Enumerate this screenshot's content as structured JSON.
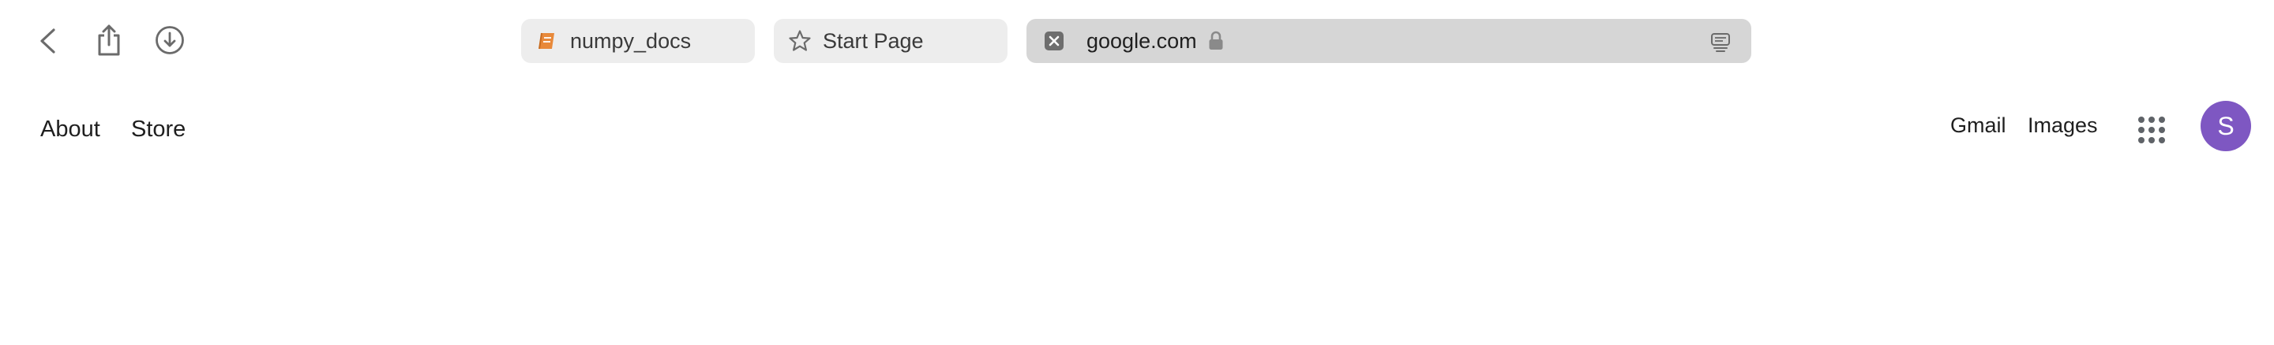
{
  "toolbar": {
    "tabs": [
      {
        "title": "numpy_docs",
        "icon": "book-icon",
        "icon_color": "#e8893a"
      },
      {
        "title": "Start Page",
        "icon": "star-outline-icon"
      },
      {
        "title": "google.com",
        "icon": "close-tab-icon",
        "active": true,
        "secure": true
      }
    ]
  },
  "google_header": {
    "left_links": [
      "About",
      "Store"
    ],
    "right_links": [
      "Gmail",
      "Images"
    ],
    "avatar_initial": "S",
    "avatar_color": "#7e57c2"
  }
}
